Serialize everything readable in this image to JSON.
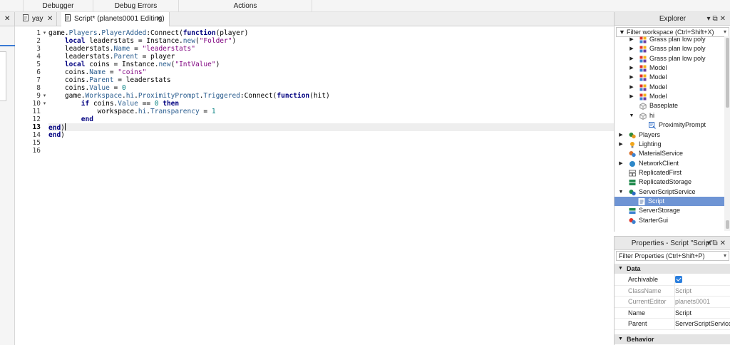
{
  "ribbon": {
    "groups": [
      "Debugger",
      "Debug Errors",
      "Actions"
    ]
  },
  "tabs": {
    "tab1_title": "yay",
    "tab2_title": "Script* (planets0001 Editing)",
    "close_glyph": "✕"
  },
  "editor": {
    "lines": [
      {
        "num": "1"
      },
      {
        "num": "2"
      },
      {
        "num": "3"
      },
      {
        "num": "4"
      },
      {
        "num": "5"
      },
      {
        "num": "6"
      },
      {
        "num": "7"
      },
      {
        "num": "8"
      },
      {
        "num": "9"
      },
      {
        "num": "10"
      },
      {
        "num": "11"
      },
      {
        "num": "12"
      },
      {
        "num": "13"
      },
      {
        "num": "14"
      },
      {
        "num": "15"
      },
      {
        "num": "16"
      }
    ],
    "code": [
      "game.Players.PlayerAdded:Connect(function(player)",
      "    local leaderstats = Instance.new(\"Folder\")",
      "    leaderstats.Name = \"leaderstats\"",
      "    leaderstats.Parent = player",
      "    local coins = Instance.new(\"IntValue\")",
      "    coins.Name = \"coins\"",
      "    coins.Parent = leaderstats",
      "    coins.Value = 0",
      "    game.Workspace.hi.ProximityPrompt.Triggered:Connect(function(hit)",
      "        if coins.Value == 0 then",
      "            workspace.hi.Transparency = 1",
      "        end",
      "end)",
      "end)",
      "",
      ""
    ],
    "current_line": "13"
  },
  "explorer": {
    "title": "Explorer",
    "filter_placeholder": "Filter workspace (Ctrl+Shift+X)",
    "items": [
      {
        "label": "Grass plan low poly",
        "icon": "model-icon"
      },
      {
        "label": "Grass plan low poly",
        "icon": "model-icon"
      },
      {
        "label": "Grass plan low poly",
        "icon": "model-icon"
      },
      {
        "label": "Model",
        "icon": "model-icon"
      },
      {
        "label": "Model",
        "icon": "model-icon"
      },
      {
        "label": "Model",
        "icon": "model-icon"
      },
      {
        "label": "Model",
        "icon": "model-icon"
      },
      {
        "label": "Baseplate",
        "icon": "part-icon"
      },
      {
        "label": "hi",
        "icon": "part-icon"
      },
      {
        "label": "ProximityPrompt",
        "icon": "proximity-prompt-icon"
      },
      {
        "label": "Players",
        "icon": "players-icon"
      },
      {
        "label": "Lighting",
        "icon": "lighting-icon"
      },
      {
        "label": "MaterialService",
        "icon": "material-icon"
      },
      {
        "label": "NetworkClient",
        "icon": "network-icon"
      },
      {
        "label": "ReplicatedFirst",
        "icon": "replicated-first-icon"
      },
      {
        "label": "ReplicatedStorage",
        "icon": "replicated-storage-icon"
      },
      {
        "label": "ServerScriptService",
        "icon": "server-script-service-icon"
      },
      {
        "label": "Script",
        "icon": "script-icon"
      },
      {
        "label": "ServerStorage",
        "icon": "server-storage-icon"
      },
      {
        "label": "StarterGui",
        "icon": "starter-gui-icon"
      }
    ]
  },
  "properties": {
    "title": "Properties - Script \"Script\"",
    "filter_placeholder": "Filter Properties (Ctrl+Shift+P)",
    "section_data": "Data",
    "section_behavior": "Behavior",
    "rows": [
      {
        "name": "Archivable",
        "value": ""
      },
      {
        "name": "ClassName",
        "value": "Script"
      },
      {
        "name": "CurrentEditor",
        "value": "planets0001"
      },
      {
        "name": "Name",
        "value": "Script"
      },
      {
        "name": "Parent",
        "value": "ServerScriptService"
      }
    ],
    "archivable_checked": true
  },
  "colors": {
    "selection": "#6e94d4",
    "keyword": "#000080",
    "string": "#7f007f",
    "number": "#007f7f",
    "checkbox": "#2b7fde"
  }
}
